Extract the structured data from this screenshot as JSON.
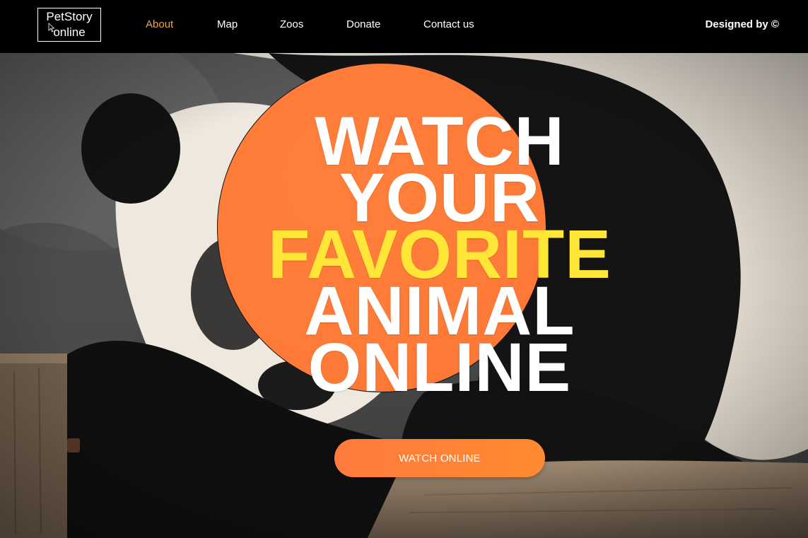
{
  "header": {
    "logo": {
      "line1": "PetStory",
      "line2": "online"
    },
    "nav": [
      {
        "label": "About",
        "active": true
      },
      {
        "label": "Map",
        "active": false
      },
      {
        "label": "Zoos",
        "active": false
      },
      {
        "label": "Donate",
        "active": false
      },
      {
        "label": "Contact us",
        "active": false
      }
    ],
    "credit": "Designed by ©"
  },
  "hero": {
    "background_image": "giant panda resting on a wooden log",
    "headline": {
      "line1": "WATCH",
      "line2": "YOUR",
      "line3": "FAVORITE",
      "line4": "ANIMAL",
      "line5": "ONLINE"
    },
    "cta_label": "WATCH ONLINE"
  },
  "colors": {
    "header_bg": "#000000",
    "nav_active": "#f7a23a",
    "circle": "#ff7b38",
    "highlight_text": "#ffe637",
    "cta": "#ff8234"
  }
}
